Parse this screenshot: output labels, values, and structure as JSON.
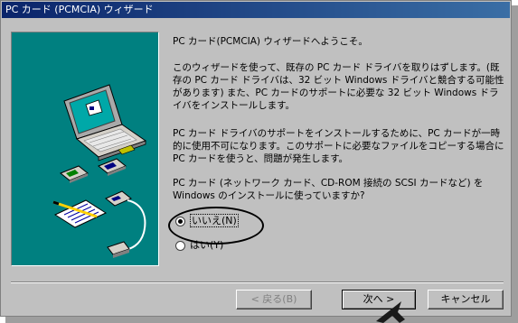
{
  "window": {
    "title": "PC カード (PCMCIA) ウィザード"
  },
  "content": {
    "heading": "PC カード(PCMCIA) ウィザードへようこそ。",
    "paragraph1": "このウィザードを使って、既存の PC カード ドライバを取りはずします。(既存の PC カード ドライバは、32 ビット Windows ドライバと競合する可能性があります) また、PC カードのサポートに必要な 32 ビット Windows ドライバをインストールします。",
    "paragraph2": "PC カード ドライバのサポートをインストールするために、PC カードが一時的に使用不可になります。このサポートに必要なファイルをコピーする場合に PC カードを使うと、問題が発生します。",
    "question": "PC カード (ネットワーク カード、CD-ROM 接続の SCSI カードなど) を Windows のインストールに使っていますか?"
  },
  "options": {
    "no_label": "いいえ(N)",
    "yes_label": "はい(Y)",
    "selected": "no"
  },
  "buttons": {
    "back_label": "< 戻る(B)",
    "next_label": "次へ >",
    "cancel_label": "キャンセル"
  },
  "colors": {
    "face": "#c0c0c0",
    "title_start": "#0a246a",
    "title_end": "#3a6ea5",
    "illustration_bg": "#008080"
  },
  "icons": [
    "laptop-icon",
    "pc-card-icon",
    "cable-icon",
    "document-icon",
    "pencil-icon",
    "arrow-cursor-icon"
  ]
}
